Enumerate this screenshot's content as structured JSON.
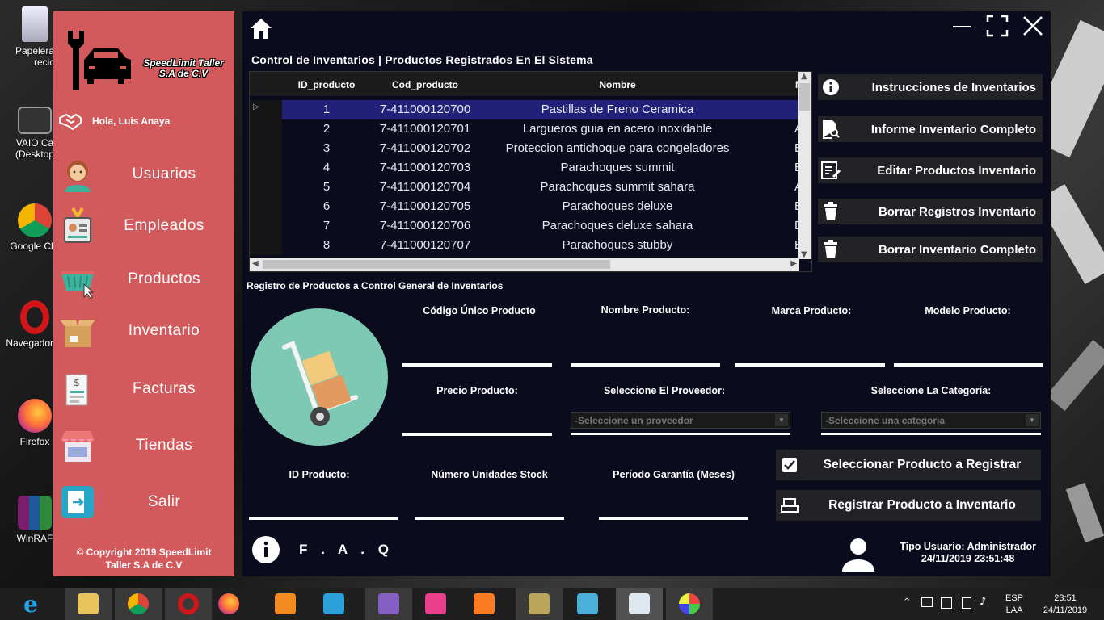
{
  "desktop": {
    "icons": [
      {
        "label_line1": "Papelera",
        "label_line2": "reciclaje",
        "icon": "recycle-bin-icon"
      },
      {
        "label_line1": "VAIO Ca",
        "label_line2": "(Desktop",
        "icon": "laptop-icon"
      },
      {
        "label_line1": "Google Chr",
        "label_line2": "",
        "icon": "chrome-icon"
      },
      {
        "label_line1": "Navegador O",
        "label_line2": "",
        "icon": "opera-icon"
      },
      {
        "label_line1": "Firefox",
        "label_line2": "",
        "icon": "firefox-icon"
      },
      {
        "label_line1": "WinRAF",
        "label_line2": "",
        "icon": "winrar-icon"
      }
    ]
  },
  "sidebar": {
    "brand_line1": "SpeedLimit Taller",
    "brand_line2": "S.A de C.V",
    "greeting": "Hola, Luis Anaya",
    "items": [
      {
        "label": "Usuarios",
        "icon": "user-icon"
      },
      {
        "label": "Empleados",
        "icon": "employee-badge-icon"
      },
      {
        "label": "Productos",
        "icon": "basket-icon"
      },
      {
        "label": "Inventario",
        "icon": "box-icon"
      },
      {
        "label": "Facturas",
        "icon": "invoice-icon"
      },
      {
        "label": "Tiendas",
        "icon": "store-icon"
      },
      {
        "label": "Salir",
        "icon": "exit-icon"
      }
    ],
    "copyright_line1": "© Copyright 2019 SpeedLimit",
    "copyright_line2": "Taller S.A de C.V"
  },
  "grid": {
    "title": "Control de Inventarios  |  Productos Registrados En El Sistema",
    "columns": [
      "ID_producto",
      "Cod_producto",
      "Nombre",
      "M"
    ],
    "rows": [
      {
        "id": "1",
        "cod": "7-411000120700",
        "nombre": "Pastillas de Freno Ceramica",
        "m": ""
      },
      {
        "id": "2",
        "cod": "7-411000120701",
        "nombre": "Largueros guia en acero inoxidable",
        "m": "A"
      },
      {
        "id": "3",
        "cod": "7-411000120702",
        "nombre": "Proteccion antichoque para congeladores",
        "m": "B"
      },
      {
        "id": "4",
        "cod": "7-411000120703",
        "nombre": "Parachoques summit",
        "m": "B"
      },
      {
        "id": "5",
        "cod": "7-411000120704",
        "nombre": "Parachoques summit sahara",
        "m": "A"
      },
      {
        "id": "6",
        "cod": "7-411000120705",
        "nombre": "Parachoques deluxe",
        "m": "B"
      },
      {
        "id": "7",
        "cod": "7-411000120706",
        "nombre": "Parachoques deluxe sahara",
        "m": "D"
      },
      {
        "id": "8",
        "cod": "7-411000120707",
        "nombre": "Parachoques stubby",
        "m": "B"
      }
    ]
  },
  "actions": [
    {
      "label": "Instrucciones de Inventarios",
      "icon": "info-icon"
    },
    {
      "label": "Informe Inventario Completo",
      "icon": "report-search-icon"
    },
    {
      "label": "Editar Productos Inventario",
      "icon": "edit-list-icon"
    },
    {
      "label": "Borrar Registros Inventario",
      "icon": "trash-icon"
    },
    {
      "label": "Borrar Inventario Completo",
      "icon": "trash-icon"
    }
  ],
  "form": {
    "title": "Registro de Productos a Control General de Inventarios",
    "labels": {
      "codigo": "Código Único Producto",
      "nombre": "Nombre Producto:",
      "marca": "Marca Producto:",
      "modelo": "Modelo Producto:",
      "precio": "Precio Producto:",
      "proveedor": "Seleccione El Proveedor:",
      "categoria": "Seleccione La Categoría:",
      "id": "ID Producto:",
      "unidades": "Número Unidades Stock",
      "garantia": "Período Garantía (Meses)"
    },
    "proveedor_value": "-Seleccione un proveedor",
    "categoria_value": "-Seleccione una categoria",
    "select_button": "Seleccionar Producto a Registrar",
    "register_button": "Registrar Producto a Inventario"
  },
  "footer": {
    "faq": "F . A . Q",
    "user_type": "Tipo Usuario: Administrador",
    "datetime": "24/11/2019 23:51:48"
  },
  "taskbar": {
    "lang": "ESP",
    "lang2": "LAA",
    "time": "23:51",
    "date": "24/11/2019"
  },
  "colors": {
    "sidebar": "#d35a5c",
    "main_bg": "#0b0b1e",
    "selected_row": "#21217a",
    "button_bg": "#232327"
  }
}
